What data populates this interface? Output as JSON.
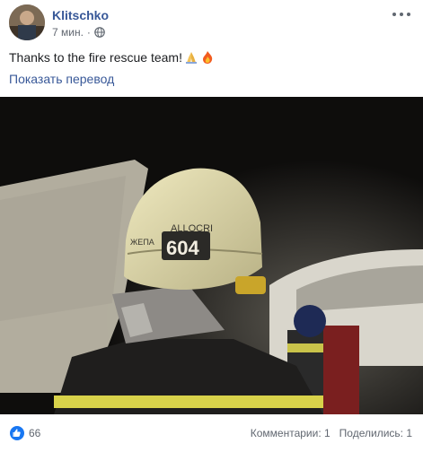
{
  "post": {
    "author": "Klitschko",
    "time": "7 мин.",
    "dot": "·",
    "audience_icon": "globe-icon",
    "text": "Thanks to the fire rescue team!",
    "emojis": [
      "folded-hands-emoji",
      "fire-emoji"
    ],
    "translate_link": "Показать перевод"
  },
  "photo": {
    "helmet_number": "604",
    "helmet_label": "ALLOCRI",
    "helmet_side_text": "ЖЕПА"
  },
  "reactions": {
    "like_icon": "thumbs-up-icon",
    "count": "66",
    "comments": "Комментарии: 1",
    "shares": "Поделились: 1"
  },
  "colors": {
    "link": "#385898",
    "like": "#1877f2",
    "helmet": "#e2dcae",
    "reflective_stripe": "#d8d24a"
  }
}
